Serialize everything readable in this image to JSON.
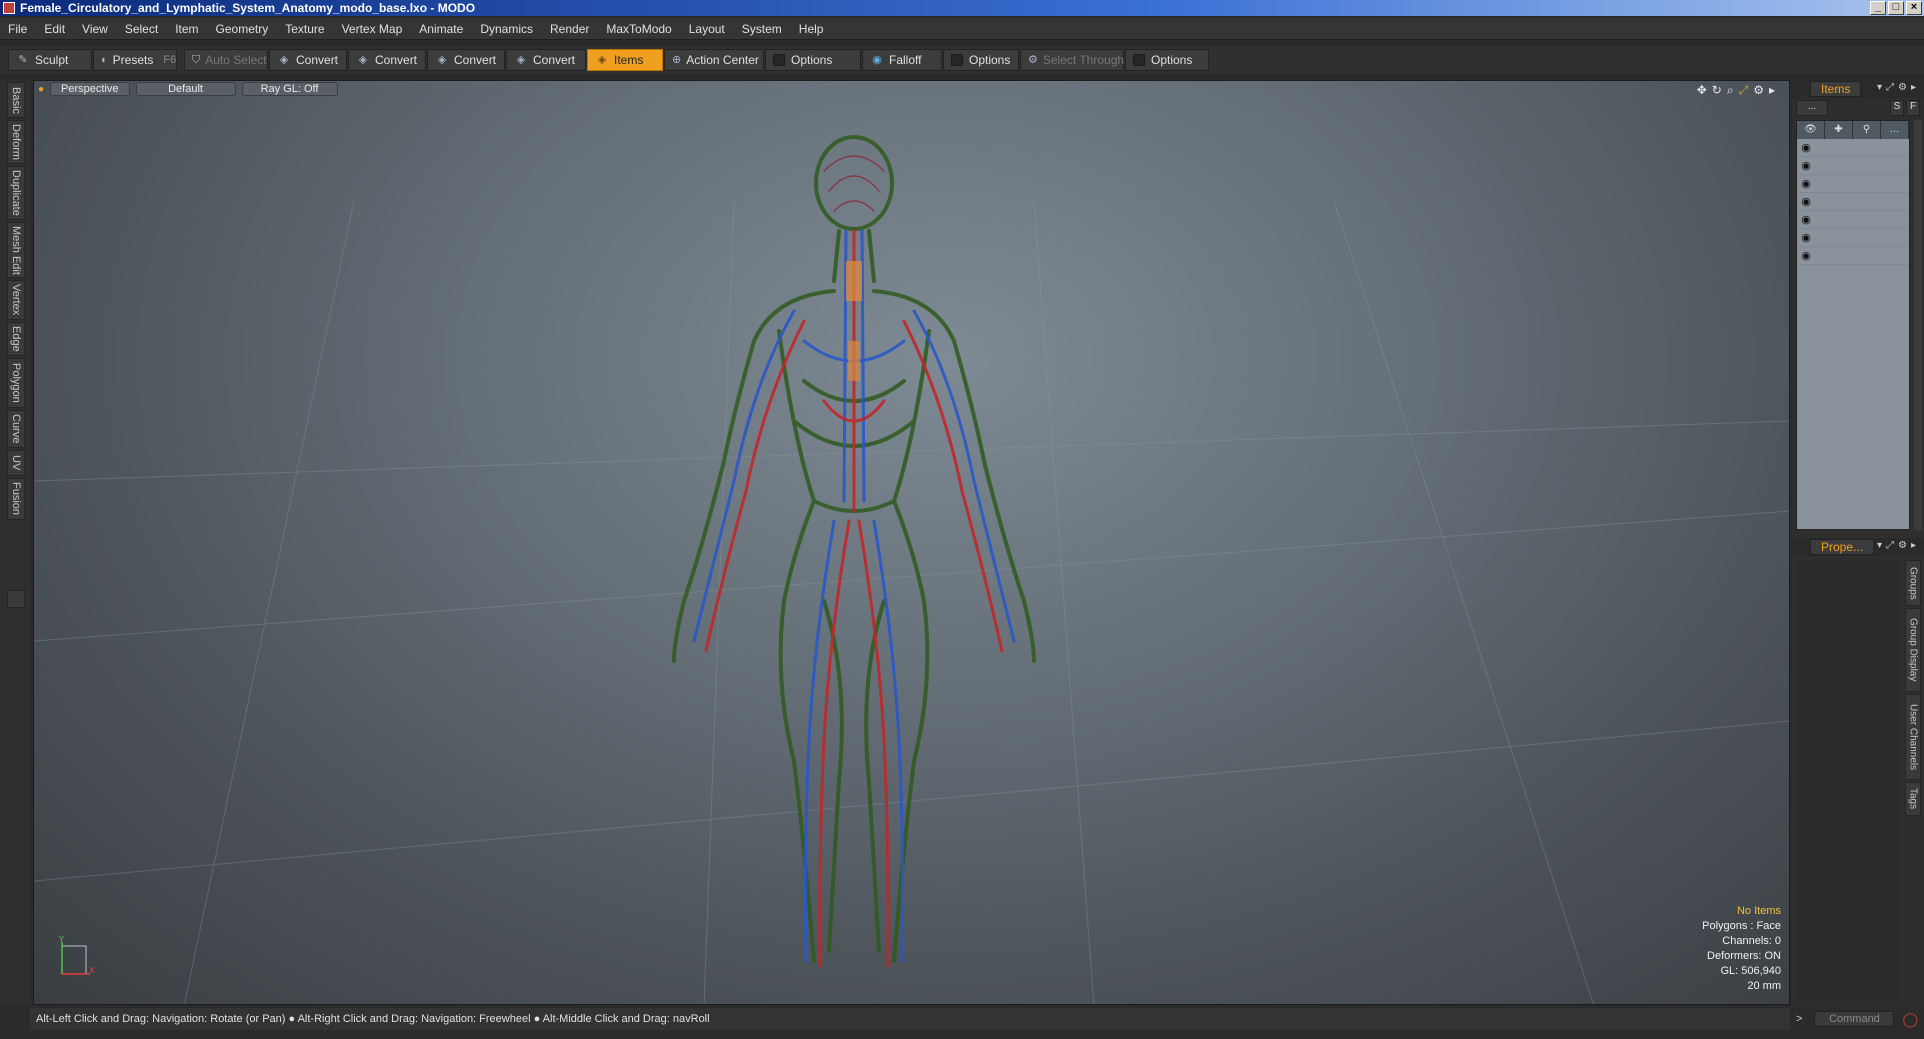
{
  "window": {
    "title": "Female_Circulatory_and_Lymphatic_System_Anatomy_modo_base.lxo - MODO"
  },
  "menu": [
    "File",
    "Edit",
    "View",
    "Select",
    "Item",
    "Geometry",
    "Texture",
    "Vertex Map",
    "Animate",
    "Dynamics",
    "Render",
    "MaxToModo",
    "Layout",
    "System",
    "Help"
  ],
  "toolbar": {
    "sculpt": "Sculpt",
    "presets": "Presets",
    "presets_key": "F6",
    "auto_select": "Auto Select",
    "convert": "Convert",
    "items": "Items",
    "action_center": "Action Center",
    "options": "Options",
    "falloff": "Falloff",
    "select_through": "Select Through"
  },
  "left_tabs": [
    "Basic",
    "Deform",
    "Duplicate",
    "Mesh Edit",
    "Vertex",
    "Edge",
    "Polygon",
    "Curve",
    "UV",
    "Fusion"
  ],
  "viewport": {
    "view": "Perspective",
    "shading": "Default",
    "raygl": "Ray GL: Off",
    "stats": {
      "items": "No Items",
      "polygons": "Polygons : Face",
      "channels": "Channels: 0",
      "deformers": "Deformers: ON",
      "gl": "GL: 506,940",
      "scale": "20 mm"
    }
  },
  "status": "Alt-Left Click and Drag: Navigation: Rotate (or Pan) ● Alt-Right Click and Drag: Navigation: Freewheel ● Alt-Middle Click and Drag: navRoll",
  "right_panel": {
    "items_tab": "Items",
    "props_tab": "Prope...",
    "list_menu": "...",
    "s_btn": "S",
    "f_btn": "F",
    "row_count": 7,
    "side_tabs": [
      "Groups",
      "Group Display",
      "User Channels",
      "Tags"
    ],
    "command_placeholder": "Command"
  },
  "colors": {
    "accent": "#f0a020",
    "artery": "#c0282a",
    "vein": "#2a58c8",
    "lymph": "#2f5a1e"
  }
}
